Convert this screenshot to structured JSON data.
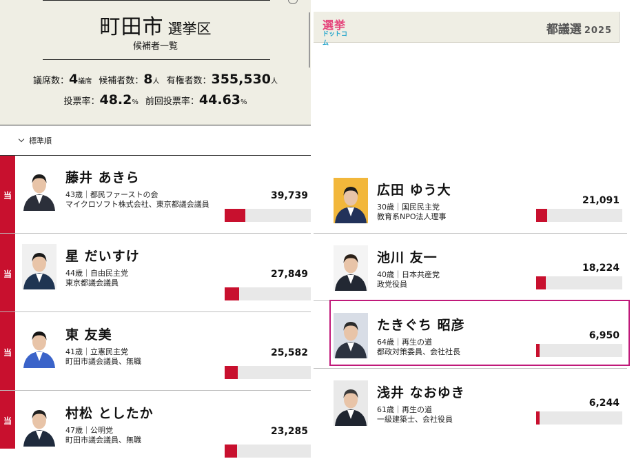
{
  "header": {
    "city": "町田市",
    "ward_suffix": "選挙区",
    "subtitle": "候補者一覧",
    "seats_label": "議席数：",
    "seats_value": "4",
    "seats_unit": "議席",
    "candidates_label": "候補者数：",
    "candidates_value": "8",
    "candidates_unit": "人",
    "voters_label": "有権者数：",
    "voters_value": "355,530",
    "voters_unit": "人",
    "turnout_label": "投票率：",
    "turnout_value": "48.2",
    "turnout_unit": "%",
    "prev_turnout_label": "前回投票率：",
    "prev_turnout_value": "44.63",
    "prev_turnout_unit": "%"
  },
  "banner": {
    "logo_top": "選挙",
    "logo_bottom": "ドットコム",
    "election": "都議選",
    "year": "2025"
  },
  "sort": {
    "label": "標準順"
  },
  "colors": {
    "elected": "#c8102e",
    "bar_bg": "#e8e8e8",
    "highlight": "#c0197a",
    "panel": "#efeee4"
  },
  "candidates_left": [
    {
      "elected_mark": "当",
      "name": "藤井 あきら",
      "meta": "43歳｜都民ファーストの会",
      "job": "マイクロソフト株式会社、東京都議会議員",
      "votes": "39,739",
      "vote_count": 39739
    },
    {
      "elected_mark": "当",
      "name": "星 だいすけ",
      "meta": "44歳｜自由民主党",
      "job": "東京都議会議員",
      "votes": "27,849",
      "vote_count": 27849
    },
    {
      "elected_mark": "当",
      "name": "東 友美",
      "meta": "41歳｜立憲民主党",
      "job": "町田市議会議員、無職",
      "votes": "25,582",
      "vote_count": 25582
    },
    {
      "elected_mark": "当",
      "name": "村松 としたか",
      "meta": "47歳｜公明党",
      "job": "町田市議会議員、無職",
      "votes": "23,285",
      "vote_count": 23285
    }
  ],
  "candidates_right": [
    {
      "name": "広田 ゆう大",
      "meta": "30歳｜国民民主党",
      "job": "教育系NPO法人理事",
      "votes": "21,091",
      "vote_count": 21091
    },
    {
      "name": "池川 友一",
      "meta": "40歳｜日本共産党",
      "job": "政党役員",
      "votes": "18,224",
      "vote_count": 18224
    },
    {
      "name": "たきぐち 昭彦",
      "meta": "64歳｜再生の道",
      "job": "都政対策委員、会社社長",
      "votes": "6,950",
      "vote_count": 6950,
      "highlighted": true
    },
    {
      "name": "浅井 なおゆき",
      "meta": "61歳｜再生の道",
      "job": "一級建築士、会社役員",
      "votes": "6,244",
      "vote_count": 6244
    }
  ],
  "bar_scale_max": 355530
}
